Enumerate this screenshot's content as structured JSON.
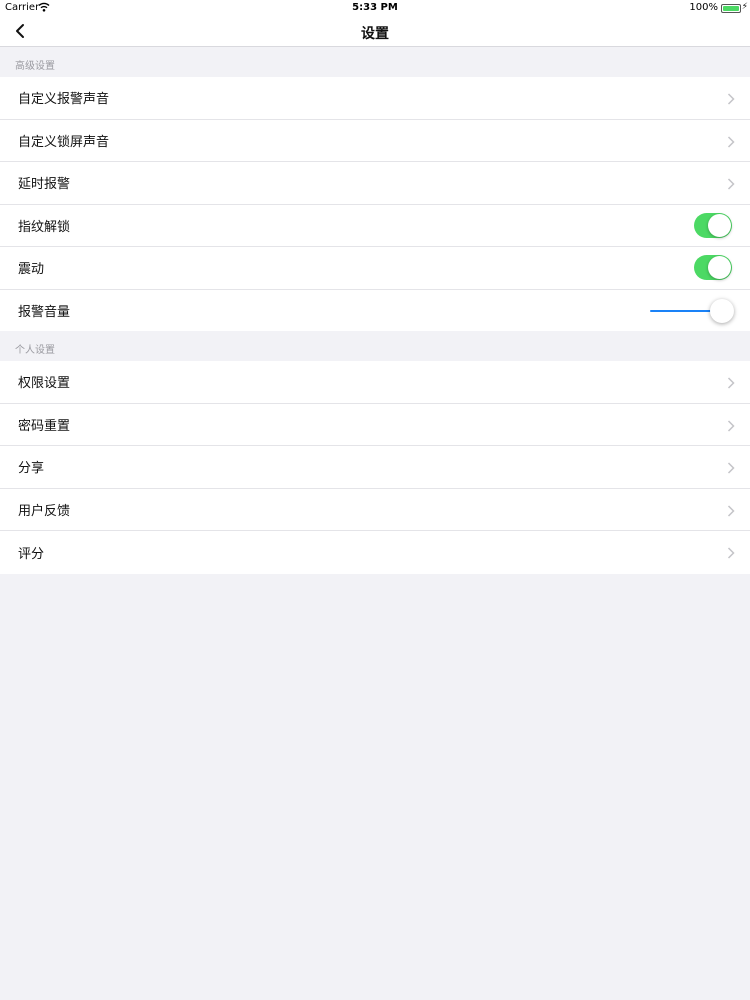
{
  "status_bar": {
    "carrier": "Carrier",
    "time": "5:33 PM",
    "battery": "100%"
  },
  "nav": {
    "title": "设置",
    "back_icon": "chevron-left-icon"
  },
  "sections": [
    {
      "header": "高级设置",
      "rows": [
        {
          "label": "自定义报警声音",
          "type": "chevron"
        },
        {
          "label": "自定义锁屏声音",
          "type": "chevron"
        },
        {
          "label": "延时报警",
          "type": "chevron"
        },
        {
          "label": "指纹解锁",
          "type": "toggle",
          "on": true
        },
        {
          "label": "震动",
          "type": "toggle",
          "on": true
        },
        {
          "label": "报警音量",
          "type": "slider",
          "value": 1.0
        }
      ]
    },
    {
      "header": "个人设置",
      "rows": [
        {
          "label": "权限设置",
          "type": "chevron"
        },
        {
          "label": "密码重置",
          "type": "chevron"
        },
        {
          "label": "分享",
          "type": "chevron"
        },
        {
          "label": "用户反馈",
          "type": "chevron"
        },
        {
          "label": "评分",
          "type": "chevron"
        }
      ]
    }
  ],
  "colors": {
    "toggle_on": "#4cd964",
    "slider_fill": "#1a82f7",
    "background": "#f2f2f6"
  }
}
